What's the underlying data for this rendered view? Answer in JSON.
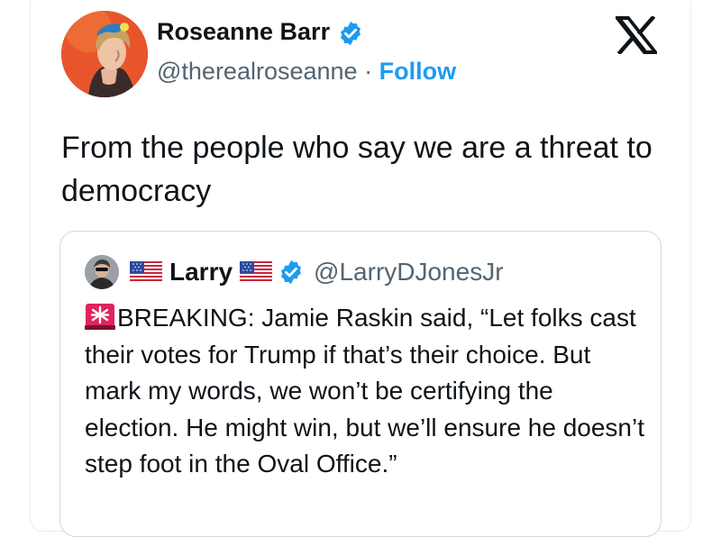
{
  "author": {
    "name": "Roseanne Barr",
    "handle": "@therealroseanne",
    "separator": "·",
    "follow_label": "Follow"
  },
  "icons": {
    "verified": "verified-badge-icon",
    "platform": "x-logo-icon",
    "flag": "us-flag-icon",
    "alert": "siren-icon"
  },
  "colors": {
    "accent": "#1d9bf0",
    "text": "#0f1419",
    "muted": "#536471"
  },
  "tweet": {
    "text": "From the people who say we are a threat to democracy"
  },
  "quoted": {
    "name": "Larry",
    "handle": "@LarryDJonesJr",
    "text": "BREAKING: Jamie Raskin said, “Let folks cast their votes for Trump if that’s their choice. But mark my words, we won’t be certifying the election. He might win, but we’ll ensure he doesn’t step foot in the Oval Office.”"
  }
}
